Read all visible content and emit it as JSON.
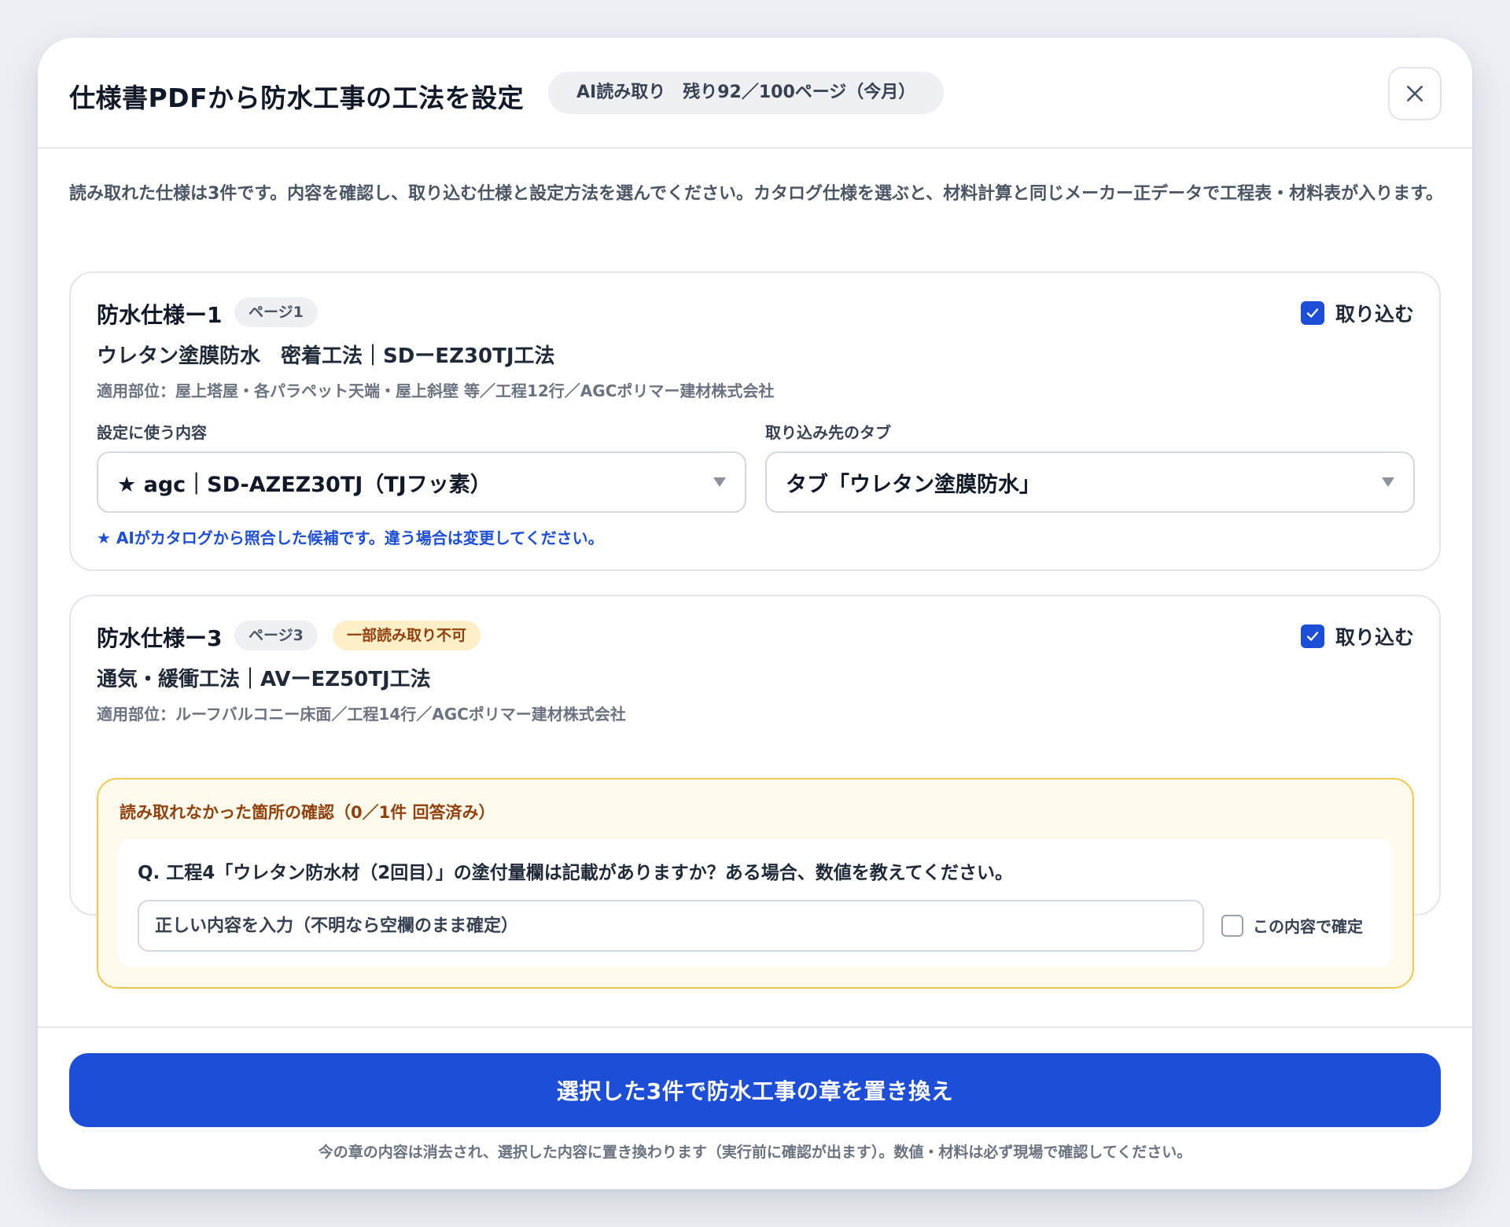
{
  "modal": {
    "title": "仕様書PDFから防水工事の工法を設定",
    "quota_badge": "AI読み取り　残り92／100ページ（今月）",
    "close_icon": "close-icon"
  },
  "intro": "読み取れた仕様は3件です。内容を確認し、取り込む仕様と設定方法を選んでください。カタログ仕様を選ぶと、材料計算と同じメーカー正データで工程表・材料表が入ります。",
  "specs": [
    {
      "title": "防水仕様ー1",
      "page_badge": "ページ1",
      "import_label": "取り込む",
      "import_checked": true,
      "name": "ウレタン塗膜防水　密着工法｜SDーEZ30TJ工法",
      "applies": "適用部位：屋上塔屋・各パラペット天端・屋上斜壁 等／工程12行／AGCポリマー建材株式会社",
      "content_label": "設定に使う内容",
      "content_value": "★ agc｜SD-AZEZ30TJ（TJフッ素）",
      "tab_label": "取り込み先のタブ",
      "tab_value": "タブ「ウレタン塗膜防水」",
      "hint": "★ AIがカタログから照合した候補です。違う場合は変更してください。"
    },
    {
      "title": "防水仕様ー3",
      "page_badge": "ページ3",
      "warn_badge": "一部読み取り不可",
      "import_label": "取り込む",
      "import_checked": true,
      "name": "通気・緩衝工法｜AVーEZ50TJ工法",
      "applies": "適用部位：ルーフバルコニー床面／工程14行／AGCポリマー建材株式会社",
      "qa": {
        "title": "読み取れなかった箇所の確認（0／1件 回答済み）",
        "question": "Q. 工程4「ウレタン防水材（2回目）」の塗付量欄は記載がありますか？ある場合、数値を教えてください。",
        "input_placeholder": "正しい内容を入力（不明なら空欄のまま確定）",
        "input_value": "",
        "confirm_label": "この内容で確定",
        "confirm_checked": false
      }
    }
  ],
  "footer": {
    "primary_button": "選択した3件で防水工事の章を置き換え",
    "note": "今の章の内容は消去され、選択した内容に置き換わります（実行前に確認が出ます）。数値・材料は必ず現場で確認してください。"
  },
  "colors": {
    "accent": "#1d4ed8",
    "warning_bg": "#fefbec",
    "warning_border": "#f3c94d",
    "warning_text": "#92400e"
  }
}
